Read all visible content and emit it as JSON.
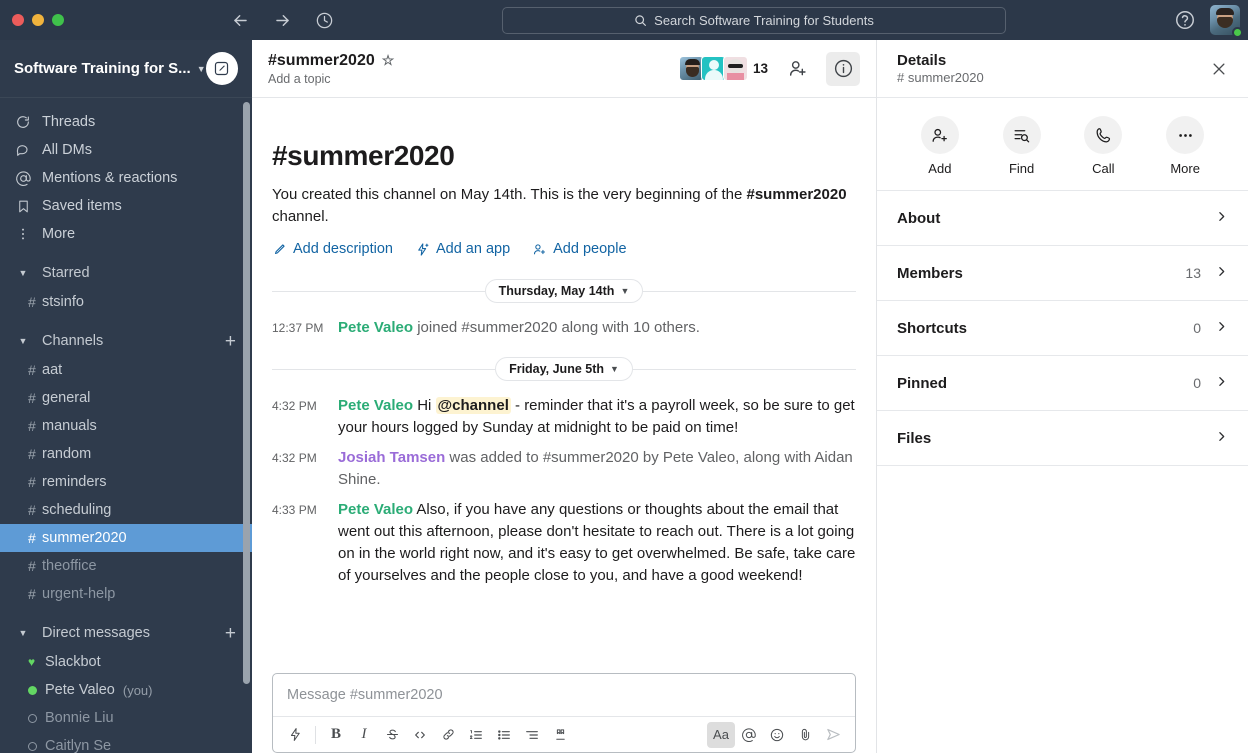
{
  "topbar": {
    "back_icon": "arrow-left-icon",
    "forward_icon": "arrow-right-icon",
    "history_icon": "clock-icon",
    "search_placeholder": "Search Software Training for Students",
    "help_icon": "help-circle-icon",
    "avatar_name": "user-avatar"
  },
  "sidebar": {
    "workspace_name": "Software Training for S...",
    "compose_label": "compose-icon",
    "nav": [
      {
        "icon": "threads-icon",
        "label": "Threads"
      },
      {
        "icon": "all-dms-icon",
        "label": "All DMs"
      },
      {
        "icon": "at-icon",
        "label": "Mentions & reactions"
      },
      {
        "icon": "bookmark-icon",
        "label": "Saved items"
      },
      {
        "icon": "more-dots-icon",
        "label": "More"
      }
    ],
    "sections": [
      {
        "name": "Starred",
        "has_add": false,
        "items": [
          {
            "label": "stsinfo",
            "active": false,
            "muted": false
          }
        ]
      },
      {
        "name": "Channels",
        "has_add": true,
        "items": [
          {
            "label": "aat",
            "active": false,
            "muted": false
          },
          {
            "label": "general",
            "active": false,
            "muted": false
          },
          {
            "label": "manuals",
            "active": false,
            "muted": false
          },
          {
            "label": "random",
            "active": false,
            "muted": false
          },
          {
            "label": "reminders",
            "active": false,
            "muted": false
          },
          {
            "label": "scheduling",
            "active": false,
            "muted": false
          },
          {
            "label": "summer2020",
            "active": true,
            "muted": false
          },
          {
            "label": "theoffice",
            "active": false,
            "muted": true
          },
          {
            "label": "urgent-help",
            "active": false,
            "muted": true
          }
        ]
      }
    ],
    "dm_section": {
      "name": "Direct messages",
      "has_add": true
    },
    "dms": [
      {
        "label": "Slackbot",
        "presence": "heart",
        "suffix": "",
        "dim": false
      },
      {
        "label": "Pete Valeo",
        "presence": "online",
        "suffix": "(you)",
        "dim": false
      },
      {
        "label": "Bonnie Liu",
        "presence": "offline",
        "suffix": "",
        "dim": true
      },
      {
        "label": "Caitlyn Se",
        "presence": "offline",
        "suffix": "",
        "dim": true
      }
    ]
  },
  "channel_header": {
    "title": "#summer2020",
    "star_icon": "star-outline-icon",
    "topic_placeholder": "Add a topic",
    "member_count": "13",
    "add_people_icon": "person-plus-icon",
    "info_icon": "info-circle-icon"
  },
  "intro": {
    "heading": "#summer2020",
    "body_part1": "You created this channel on May 14th. This is the very beginning of the ",
    "body_channel": "#summer2020",
    "body_part2": " channel.",
    "actions": [
      {
        "icon": "pencil-icon",
        "label": "Add description"
      },
      {
        "icon": "app-bolt-icon",
        "label": "Add an app"
      },
      {
        "icon": "person-plus-icon",
        "label": "Add people"
      }
    ]
  },
  "messages": [
    {
      "type": "divider",
      "label": "Thursday, May 14th"
    },
    {
      "type": "system",
      "time": "12:37 PM",
      "author": "Pete Valeo",
      "author_color": "green",
      "text": " joined #summer2020 along with 10 others."
    },
    {
      "type": "divider",
      "label": "Friday, June 5th"
    },
    {
      "type": "message",
      "time": "4:32 PM",
      "author": "Pete Valeo",
      "author_color": "green",
      "text_before": " Hi ",
      "mention": "@channel",
      "text_after": " - reminder that it's a payroll week, so be sure to get your hours logged by Sunday at midnight to be paid on time!"
    },
    {
      "type": "system",
      "time": "4:32 PM",
      "author": "Josiah Tamsen",
      "author_color": "purple",
      "text": " was added to #summer2020 by Pete Valeo, along with Aidan Shine."
    },
    {
      "type": "message",
      "time": "4:33 PM",
      "author": "Pete Valeo",
      "author_color": "green",
      "text_before": " Also, if you have any questions or thoughts about the email that went out this afternoon, please don't hesitate to reach out. There is a lot going on in the world right now, and it's easy to get overwhelmed. Be safe, take care of yourselves and the people close to you, and have a good weekend!",
      "mention": "",
      "text_after": ""
    }
  ],
  "composer": {
    "placeholder": "Message #summer2020",
    "tools": [
      {
        "name": "shortcuts-lightning-icon",
        "glyph": "⚡"
      },
      {
        "name": "bold-icon",
        "glyph": "B"
      },
      {
        "name": "italic-icon",
        "glyph": "I"
      },
      {
        "name": "strikethrough-icon",
        "glyph": "S"
      },
      {
        "name": "code-icon",
        "glyph": "</>"
      },
      {
        "name": "link-icon",
        "glyph": "🔗"
      },
      {
        "name": "ordered-list-icon",
        "glyph": "1."
      },
      {
        "name": "bulleted-list-icon",
        "glyph": "•"
      },
      {
        "name": "blockquote-icon",
        "glyph": "”"
      },
      {
        "name": "code-block-icon",
        "glyph": "⌨"
      },
      {
        "name": "formatting-aa-icon",
        "glyph": "Aa"
      },
      {
        "name": "mention-at-icon",
        "glyph": "@"
      },
      {
        "name": "emoji-icon",
        "glyph": "☺"
      },
      {
        "name": "attachment-icon",
        "glyph": "📎"
      },
      {
        "name": "send-icon",
        "glyph": "➤"
      }
    ]
  },
  "details": {
    "title": "Details",
    "subtitle": "# summer2020",
    "close_icon": "close-icon",
    "actions": [
      {
        "icon": "person-plus-icon",
        "label": "Add"
      },
      {
        "icon": "find-search-icon",
        "label": "Find"
      },
      {
        "icon": "phone-icon",
        "label": "Call"
      },
      {
        "icon": "more-dots-icon",
        "label": "More"
      }
    ],
    "rows": [
      {
        "label": "About",
        "count": ""
      },
      {
        "label": "Members",
        "count": "13"
      },
      {
        "label": "Shortcuts",
        "count": "0"
      },
      {
        "label": "Pinned",
        "count": "0"
      },
      {
        "label": "Files",
        "count": ""
      }
    ]
  },
  "colors": {
    "sidebar_bg": "#2f3b4c",
    "titlebar_bg": "#2c3849",
    "active_channel": "#5e9bd6",
    "link_blue": "#1264a3",
    "name_green": "#2bac76",
    "name_purple": "#9a6cd8",
    "mention_bg": "#fdf3d1"
  }
}
